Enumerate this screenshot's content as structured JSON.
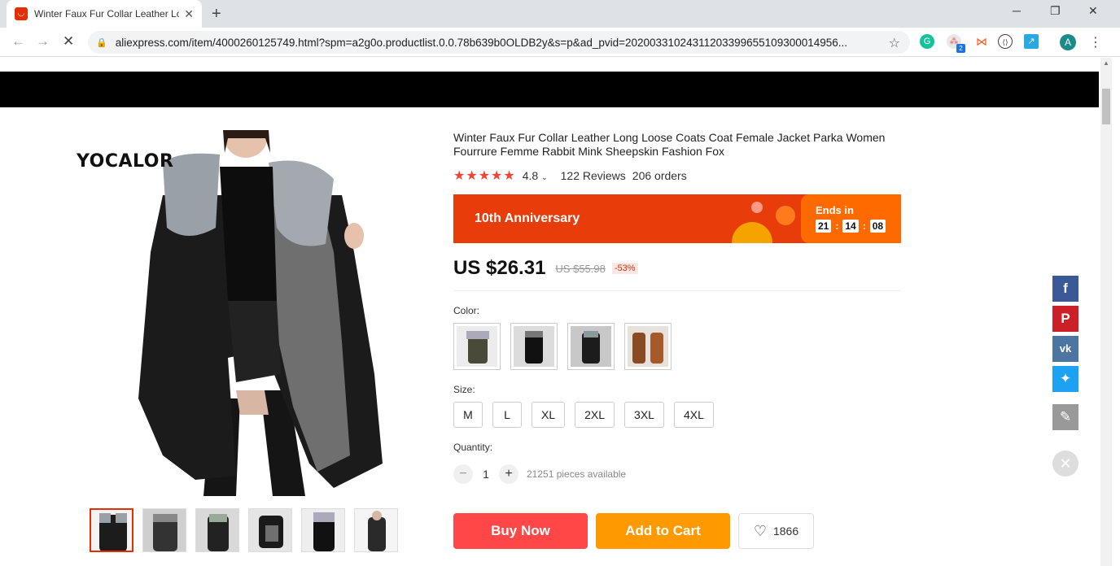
{
  "browser": {
    "tab_title": "Winter Faux Fur Collar Leather Lo",
    "url": "aliexpress.com/item/4000260125749.html?spm=a2g0o.productlist.0.0.78b639b0OLDB2y&s=p&ad_pvid=20200331024311203399655109300014956...",
    "avatar_letter": "A",
    "ext_badge": "2"
  },
  "product": {
    "brand_watermark": "YOCALOR",
    "title": "Winter Faux Fur Collar Leather Long Loose Coats Coat Female Jacket Parka Women Fourrure Femme Rabbit Mink Sheepskin Fashion Fox",
    "rating": "4.8",
    "reviews": "122 Reviews",
    "orders": "206 orders",
    "rating_value": 4.8
  },
  "promo": {
    "label": "10th Anniversary",
    "ends_label": "Ends in",
    "hours": "21",
    "minutes": "14",
    "seconds": "08",
    "sep": ":"
  },
  "price": {
    "current": "US $26.31",
    "original": "US $55.98",
    "discount": "-53%"
  },
  "options": {
    "color_label": "Color:",
    "size_label": "Size:",
    "sizes": [
      "M",
      "L",
      "XL",
      "2XL",
      "3XL",
      "4XL"
    ],
    "quantity_label": "Quantity:",
    "quantity": "1",
    "available": "21251 pieces available"
  },
  "actions": {
    "buy_now": "Buy Now",
    "add_to_cart": "Add to Cart",
    "wishlist_count": "1866"
  },
  "colors": {
    "accent": "#e62e04",
    "buy": "#ff4747",
    "cart": "#ff9900",
    "banner": "#e83c0a",
    "facebook": "#3b5998",
    "pinterest": "#cb2027",
    "vk": "#4c75a3",
    "twitter": "#1da1f2",
    "edit": "#999999"
  }
}
